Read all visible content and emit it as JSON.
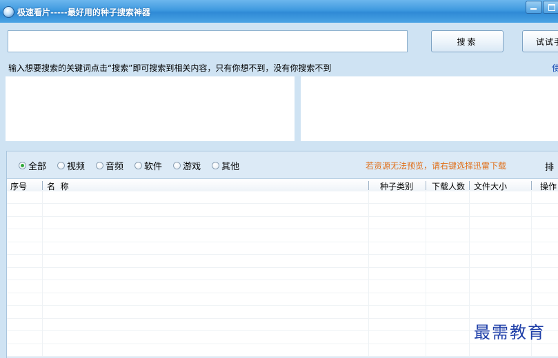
{
  "window": {
    "title": "极速看片-----最好用的种子搜索神器",
    "icon": "app-logo-icon"
  },
  "search": {
    "value": "",
    "placeholder": "",
    "button_label": "搜索",
    "try_button_label": "试试手"
  },
  "hint": {
    "text": "输入想要搜索的关键词点击“搜索”即可搜索到相关内容，只有你想不到，没有你搜索不到",
    "right_text": "使"
  },
  "filters": {
    "options": [
      "全部",
      "视频",
      "音频",
      "软件",
      "游戏",
      "其他"
    ],
    "selected": "全部"
  },
  "notice": "若资源无法预览，请右键选择迅雷下载",
  "sort_label": "排",
  "table": {
    "columns": [
      "序号",
      "名  称",
      "种子类别",
      "下载人数",
      "文件大小",
      "操作"
    ],
    "rows": []
  },
  "watermark": "最需教育",
  "colors": {
    "titlebar": "#3e99df",
    "background": "#cfe3f3",
    "notice": "#e0701b",
    "selected_radio": "#2fa83a",
    "watermark": "#1f3fa8"
  }
}
